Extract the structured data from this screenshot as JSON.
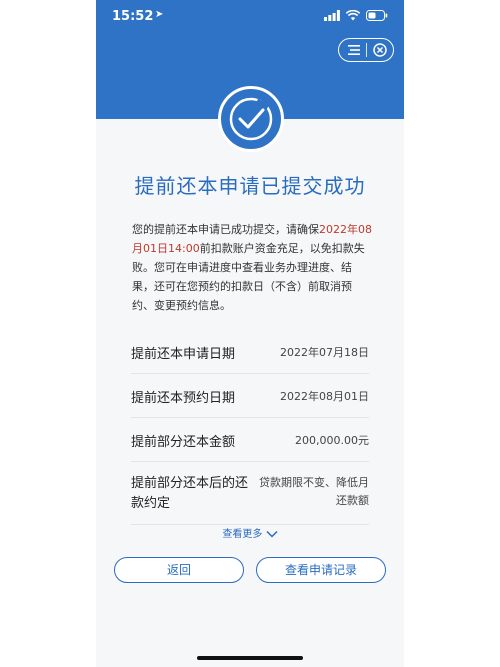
{
  "status_bar": {
    "time": "15:52"
  },
  "result": {
    "title": "提前还本申请已提交成功",
    "message_pre": "您的提前还本申请已成功提交，请确保",
    "message_highlight": "2022年08月01日14:00",
    "message_post": "前扣款账户资金充足，以免扣款失败。您可在申请进度中查看业务办理进度、结果，还可在您预约的扣款日（不含）前取消预约、变更预约信息。"
  },
  "details": [
    {
      "label": "提前还本申请日期",
      "value": "2022年07月18日"
    },
    {
      "label": "提前还本预约日期",
      "value": "2022年08月01日"
    },
    {
      "label": "提前部分还本金额",
      "value": "200,000.00元"
    },
    {
      "label": "提前部分还本后的还款约定",
      "value": "贷款期限不变、降低月还款额"
    }
  ],
  "view_more": "查看更多",
  "buttons": {
    "back": "返回",
    "view_records": "查看申请记录"
  },
  "colors": {
    "primary": "#2f73c6",
    "highlight": "#c0392b"
  }
}
